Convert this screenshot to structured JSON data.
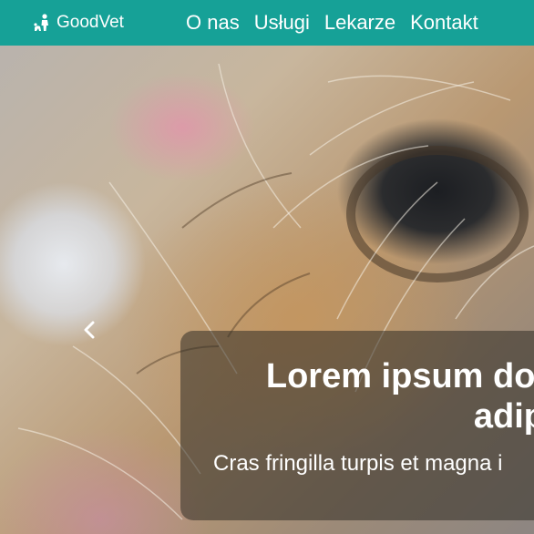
{
  "brand": {
    "name": "GoodVet",
    "icon": "pet-owner-icon"
  },
  "nav": {
    "items": [
      {
        "label": "O nas"
      },
      {
        "label": "Usługi"
      },
      {
        "label": "Lekarze"
      },
      {
        "label": "Kontakt"
      }
    ]
  },
  "carousel": {
    "prev_icon": "chevron-left-icon",
    "caption": {
      "title_line1": "Lorem ipsum dol",
      "title_line2": "adip",
      "subtitle": "Cras fringilla turpis et magna i"
    }
  },
  "colors": {
    "navbar": "#16a197"
  }
}
